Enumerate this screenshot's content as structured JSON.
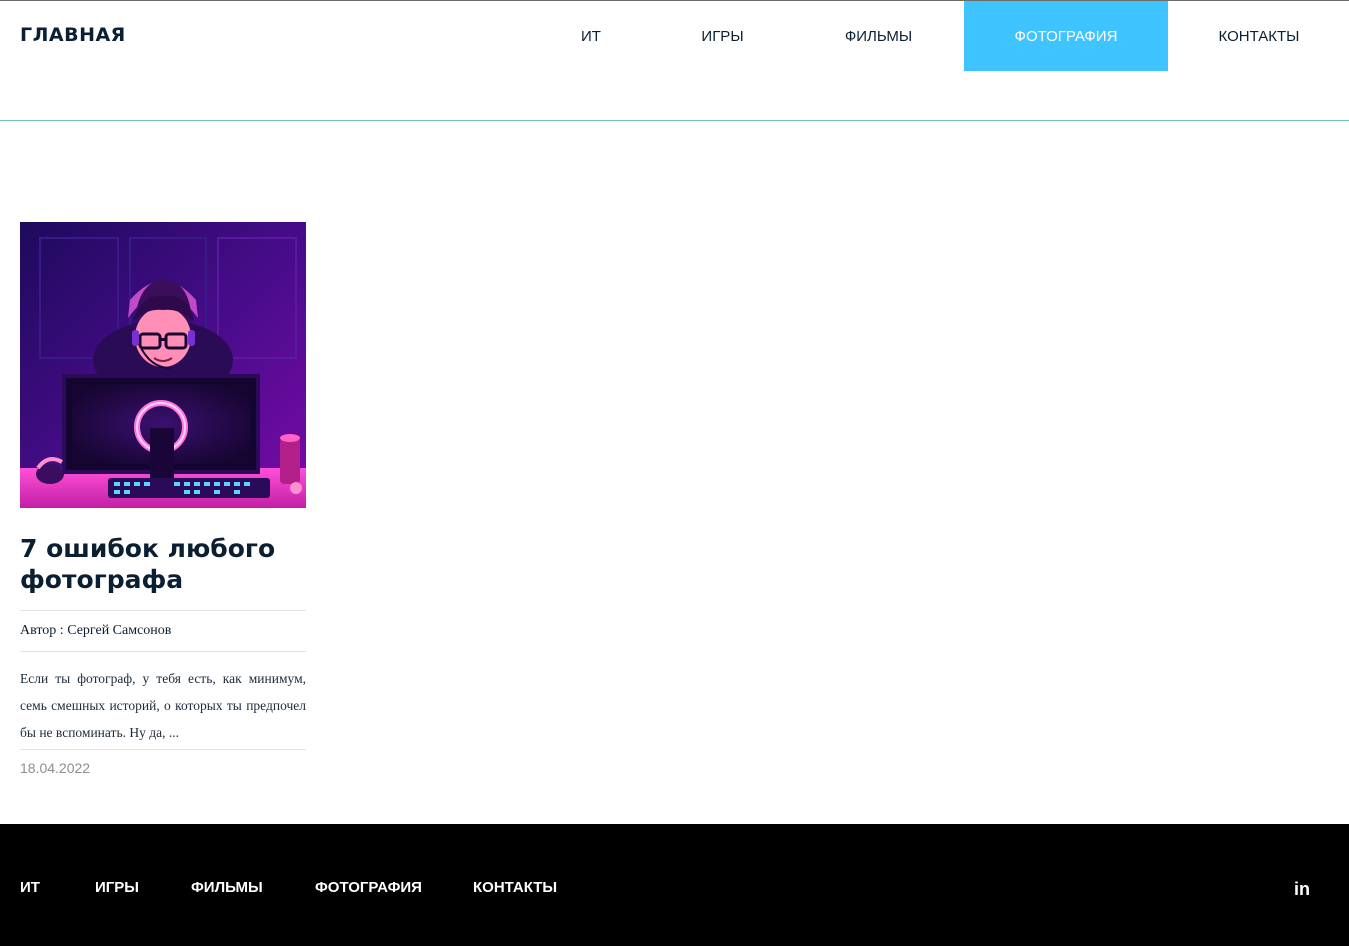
{
  "header": {
    "logo": "ГЛАВНАЯ",
    "nav": [
      {
        "label": "ИТ",
        "active": false
      },
      {
        "label": "ИГРЫ",
        "active": false
      },
      {
        "label": "ФИЛЬМЫ",
        "active": false
      },
      {
        "label": "ФОТОГРАФИЯ",
        "active": true
      },
      {
        "label": "КОНТАКТЫ",
        "active": false
      }
    ]
  },
  "article": {
    "title": "7 ошибок любого фотографа",
    "author": "Автор : Сергей Самсонов",
    "excerpt": "Если ты фотограф, у тебя есть, как минимум, семь смешных историй, о которых ты предпочел бы не вспоминать. Ну да, ...",
    "date": "18.04.2022",
    "image_icon": "gamer-illustration"
  },
  "footer": {
    "nav": [
      "ИТ",
      "ИГРЫ",
      "ФИЛЬМЫ",
      "ФОТОГРАФИЯ",
      "КОНТАКТЫ"
    ],
    "social_icon": "linkedin-icon",
    "social_label": "in"
  },
  "colors": {
    "accent": "#40c4ff",
    "text": "#0b1f33",
    "footer_bg": "#000000",
    "header_line": "#6fc7c0"
  }
}
